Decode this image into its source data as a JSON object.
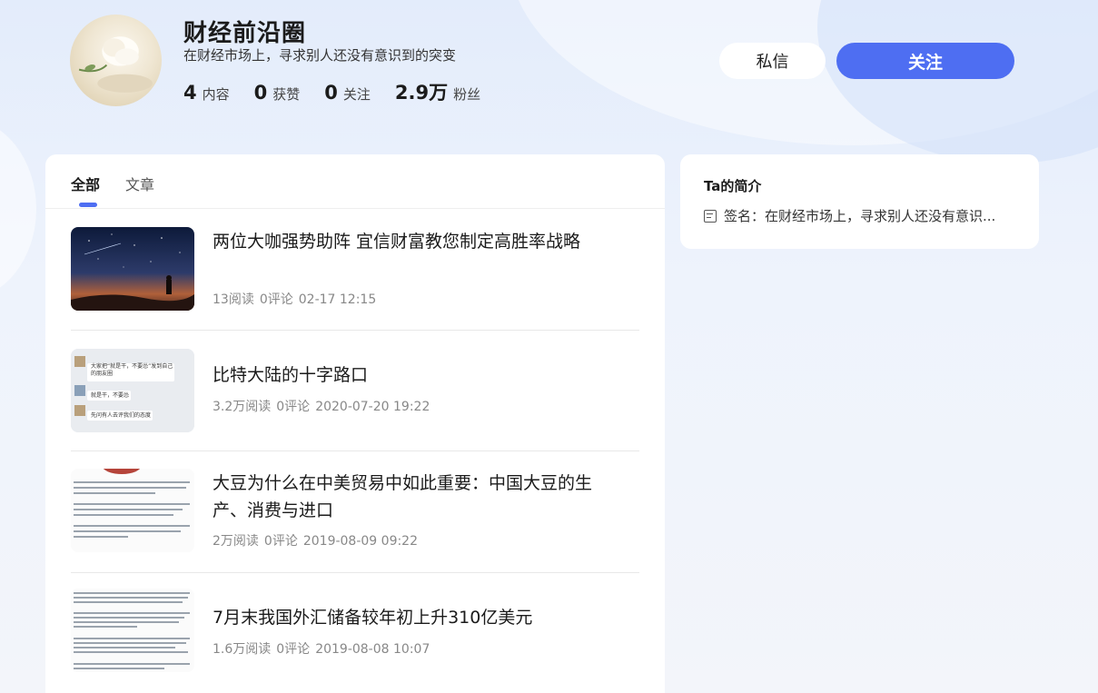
{
  "profile": {
    "name": "财经前沿圈",
    "signature": "在财经市场上，寻求别人还没有意识到的突变",
    "stats": [
      {
        "num": "4",
        "label": "内容"
      },
      {
        "num": "0",
        "label": "获赞"
      },
      {
        "num": "0",
        "label": "关注"
      },
      {
        "num": "2.9万",
        "label": "粉丝"
      }
    ],
    "message_label": "私信",
    "follow_label": "关注"
  },
  "tabs": [
    {
      "label": "全部",
      "active": true
    },
    {
      "label": "文章",
      "active": false
    }
  ],
  "articles": [
    {
      "title": "两位大咖强势助阵 宜信财富教您制定高胜率战略",
      "reads": "13阅读",
      "comments": "0评论",
      "time": "02-17 12:15",
      "thumb": "starry-sky"
    },
    {
      "title": "比特大陆的十字路口",
      "reads": "3.2万阅读",
      "comments": "0评论",
      "time": "2020-07-20 19:22",
      "thumb": "chat-screenshot"
    },
    {
      "title": "大豆为什么在中美贸易中如此重要：中国大豆的生产、消费与进口",
      "reads": "2万阅读",
      "comments": "0评论",
      "time": "2019-08-09 09:22",
      "thumb": "text-document"
    },
    {
      "title": "7月末我国外汇储备较年初上升310亿美元",
      "reads": "1.6万阅读",
      "comments": "0评论",
      "time": "2019-08-08 10:07",
      "thumb": "text-document"
    }
  ],
  "thumb_texts": {
    "chat": [
      "大家把“就是干，不要怂”发到自己的朋友圈",
      "就是干，不要怂",
      "先问有人去评我们的态度"
    ]
  },
  "sidebar": {
    "title": "Ta的简介",
    "signature": "签名：在财经市场上，寻求别人还没有意识..."
  },
  "colors": {
    "accent": "#4e6ef2",
    "background": "#edf2fb"
  }
}
